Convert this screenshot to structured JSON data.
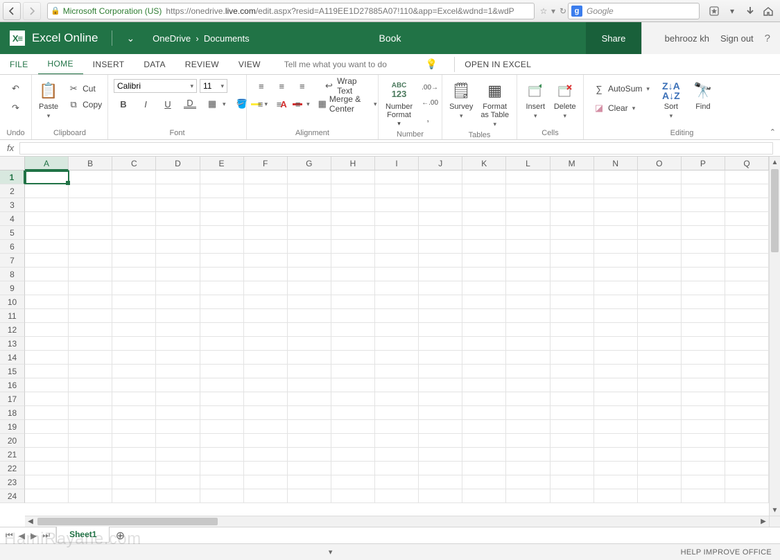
{
  "browser": {
    "identity": "Microsoft Corporation (US)",
    "url_prefix": "https://onedrive.",
    "url_host": "live.com",
    "url_rest": "/edit.aspx?resid=A119EE1D27885A07!110&app=Excel&wdnd=1&wdP",
    "search_placeholder": "Google"
  },
  "header": {
    "app_name": "Excel Online",
    "breadcrumb1": "OneDrive",
    "breadcrumb2": "Documents",
    "doc_title": "Book",
    "share": "Share",
    "user": "behrooz kh",
    "signout": "Sign out"
  },
  "tabs": {
    "file": "FILE",
    "home": "HOME",
    "insert": "INSERT",
    "data": "DATA",
    "review": "REVIEW",
    "view": "VIEW",
    "tellme": "Tell me what you want to do",
    "open_excel": "OPEN IN EXCEL"
  },
  "ribbon": {
    "undo_group": "Undo",
    "clipboard_group": "Clipboard",
    "font_group": "Font",
    "alignment_group": "Alignment",
    "number_group": "Number",
    "tables_group": "Tables",
    "cells_group": "Cells",
    "editing_group": "Editing",
    "paste": "Paste",
    "cut": "Cut",
    "copy": "Copy",
    "font_name": "Calibri",
    "font_size": "11",
    "wrap": "Wrap Text",
    "merge": "Merge & Center",
    "number_format": "Number Format",
    "survey": "Survey",
    "format_table": "Format as Table",
    "insert": "Insert",
    "delete": "Delete",
    "autosum": "AutoSum",
    "clear": "Clear",
    "sort": "Sort",
    "find": "Find",
    "abc": "ABC",
    "num123": "123"
  },
  "grid": {
    "columns": [
      "A",
      "B",
      "C",
      "D",
      "E",
      "F",
      "G",
      "H",
      "I",
      "J",
      "K",
      "L",
      "M",
      "N",
      "O",
      "P",
      "Q"
    ],
    "rows": [
      1,
      2,
      3,
      4,
      5,
      6,
      7,
      8,
      9,
      10,
      11,
      12,
      13,
      14,
      15,
      16,
      17,
      18,
      19,
      20,
      21,
      22,
      23,
      24
    ],
    "selected_col": "A",
    "selected_row": 1
  },
  "sheets": {
    "active": "Sheet1"
  },
  "status": {
    "help": "HELP IMPROVE OFFICE"
  },
  "watermark": "HamiRayane.com"
}
